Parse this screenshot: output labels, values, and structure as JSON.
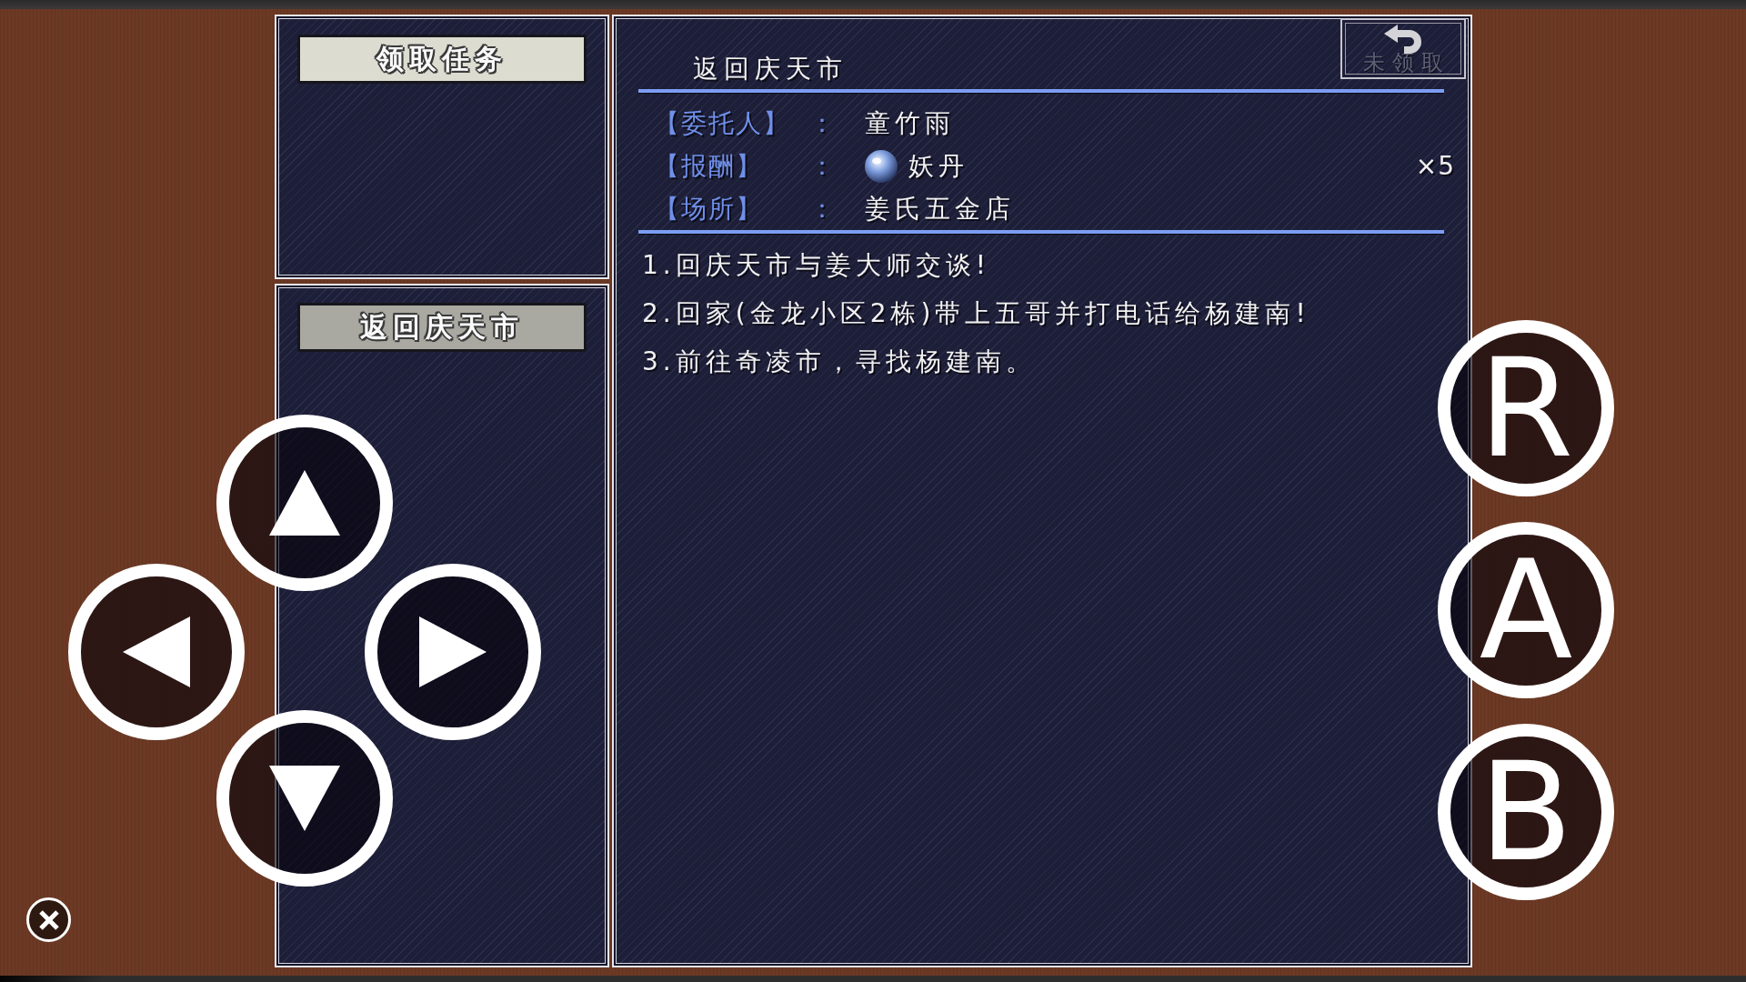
{
  "quest_menu": {
    "accept_button": "领取任务"
  },
  "quest_list": [
    {
      "title": "返回庆天市",
      "selected": true
    }
  ],
  "quest_detail": {
    "title": "返回庆天市",
    "status": "未领取",
    "info": [
      {
        "kind": "text",
        "label": "【委托人】",
        "separator": "：",
        "value": "童竹雨"
      },
      {
        "kind": "item",
        "label": "【报酬】",
        "separator": "：",
        "value": "妖丹",
        "quantity": "×5"
      },
      {
        "kind": "text",
        "label": "【场所】",
        "separator": "：",
        "value": "姜氏五金店"
      }
    ],
    "steps": [
      "1.回庆天市与姜大师交谈!",
      "2.回家(金龙小区2栋)带上五哥并打电话给杨建南!",
      "3.前往奇凌市，寻找杨建南。"
    ]
  },
  "action_buttons": [
    "R",
    "A",
    "B"
  ]
}
